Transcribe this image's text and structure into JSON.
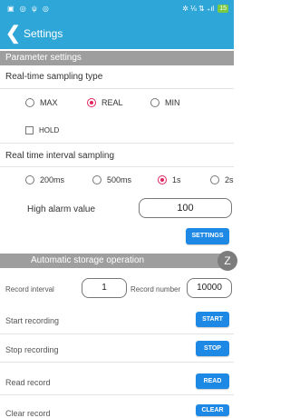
{
  "status": {
    "left_icons": "▣ ◎ ψ ◎",
    "right_text": "✲ ⅛ ⇅ ₊ıl",
    "battery": "15"
  },
  "appbar": {
    "title": "Settings"
  },
  "parameter_settings": {
    "header": "Parameter settings",
    "sampling_type_label": "Real-time sampling type",
    "radio_max": "MAX",
    "radio_real": "REAL",
    "radio_min": "MIN",
    "hold_label": "HOLD",
    "interval_label": "Real time interval sampling",
    "interval_200": "200ms",
    "interval_500": "500ms",
    "interval_1s": "1s",
    "interval_2s": "2s",
    "alarm_label": "High alarm value",
    "alarm_value": "100",
    "settings_button": "SETTINGS"
  },
  "storage": {
    "header": "Automatic storage operation",
    "record_interval_label": "Record interval",
    "record_interval_value": "1",
    "record_number_label": "Record number",
    "record_number_value": "10000",
    "start_label": "Start recording",
    "start_button": "START",
    "stop_label": "Stop recording",
    "stop_button": "STOP",
    "read_label": "Read record",
    "read_button": "READ",
    "clear_label": "Clear record",
    "clear_button": "CLEAR"
  },
  "fab_label": "Z"
}
